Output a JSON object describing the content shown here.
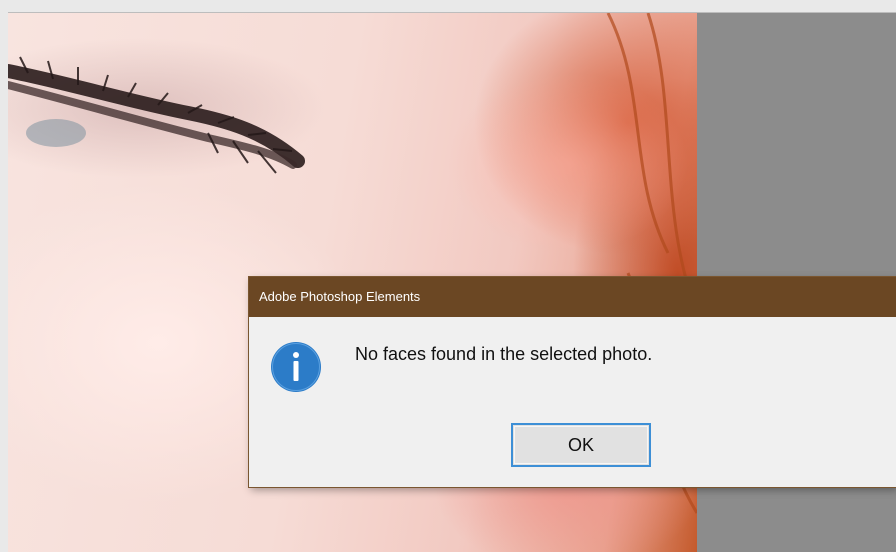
{
  "dialog": {
    "title": "Adobe Photoshop Elements",
    "message": "No faces found in the selected photo.",
    "ok_label": "OK",
    "icon": "info-icon"
  },
  "colors": {
    "titlebar": "#6b4723",
    "dialog_bg": "#f0f0f0",
    "workspace": "#8c8c8c",
    "info_icon": "#2c7cc8",
    "button_focus_border": "#3d8fd6"
  },
  "photo": {
    "icon": "photo-canvas"
  }
}
